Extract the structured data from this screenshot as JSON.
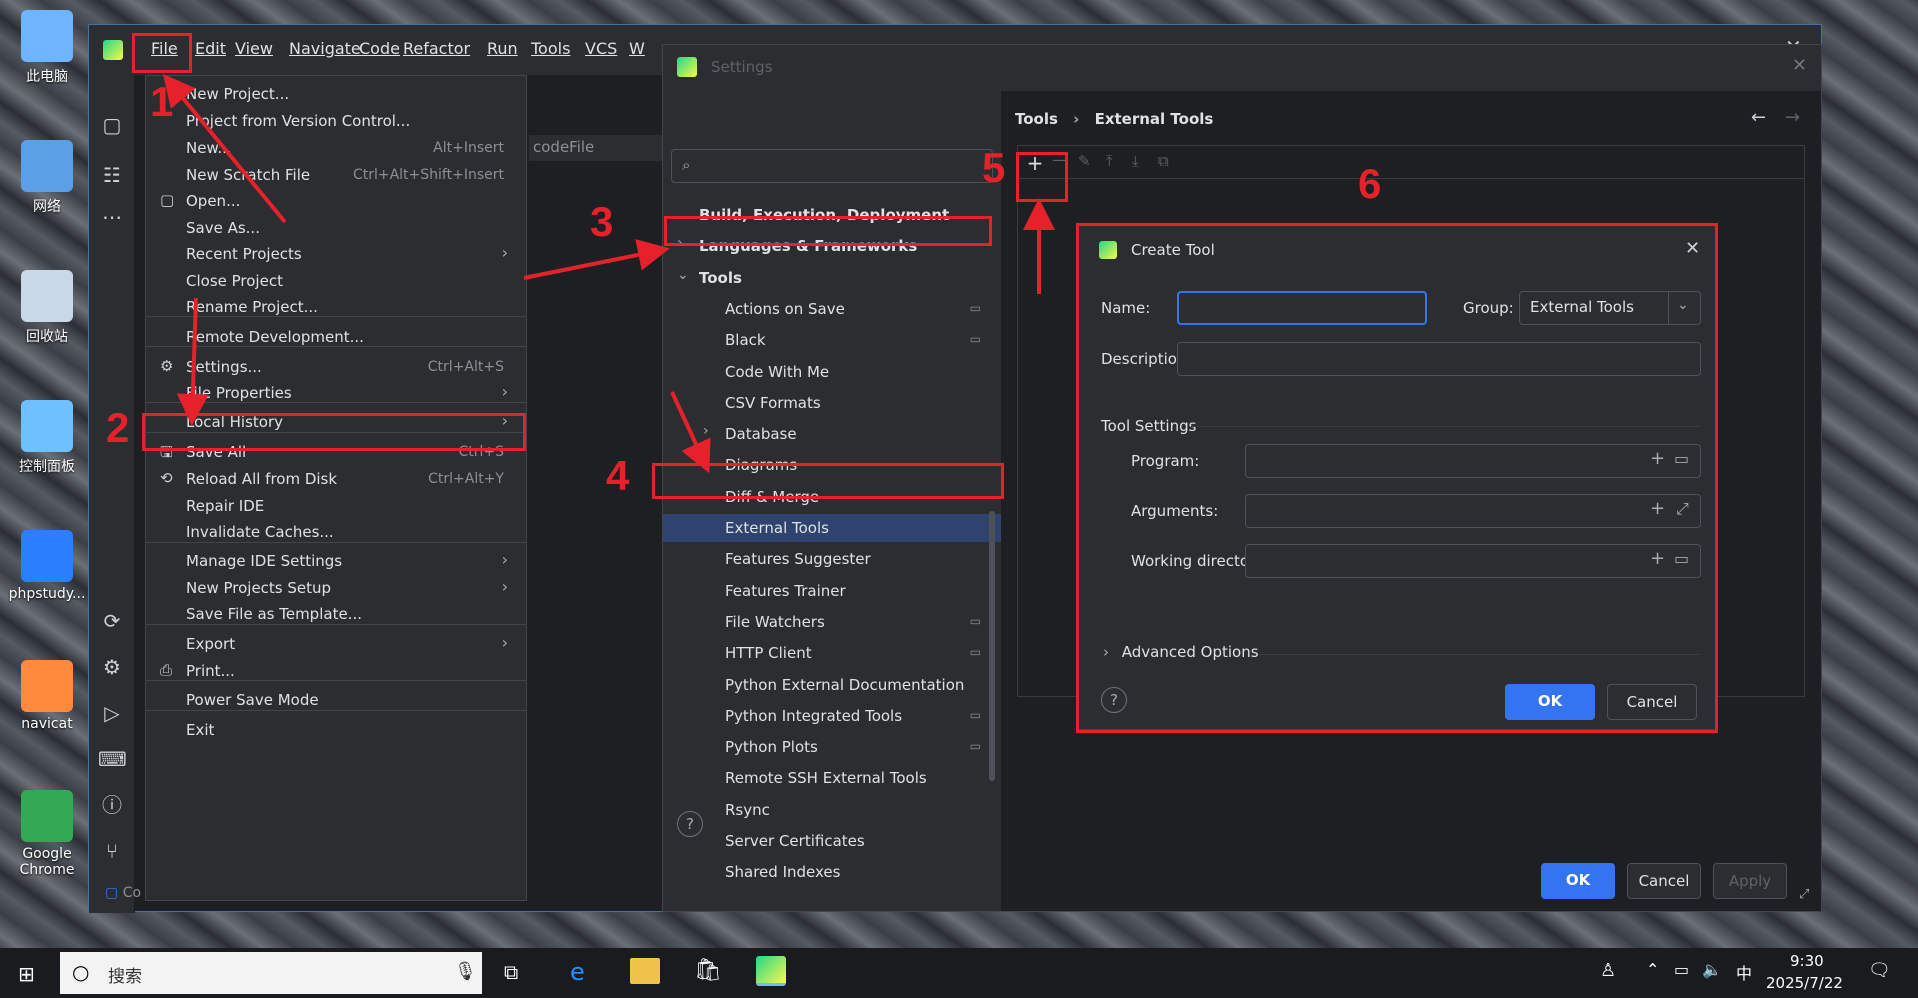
{
  "desktop": {
    "icons": [
      {
        "label": "此电脑",
        "icon": "computer-icon"
      },
      {
        "label": "网络",
        "icon": "network-icon"
      },
      {
        "label": "回收站",
        "icon": "recycle-bin-icon"
      },
      {
        "label": "控制面板",
        "icon": "control-panel-icon"
      },
      {
        "label": "phpstudy...",
        "icon": "phpstudy-icon"
      },
      {
        "label": "navicat",
        "icon": "navicat-icon"
      },
      {
        "label": "Google Chrome",
        "icon": "chrome-icon"
      }
    ]
  },
  "ide": {
    "menu": [
      "File",
      "Edit",
      "View",
      "Navigate",
      "Code",
      "Refactor",
      "Run",
      "Tools",
      "VCS",
      "W"
    ],
    "tab_fragment": "codeFile",
    "status_fragment": "Co"
  },
  "file_menu": {
    "items": [
      {
        "label": "New Project...",
        "shortcut": "",
        "submenu": false,
        "icon": ""
      },
      {
        "label": "Project from Version Control...",
        "shortcut": "",
        "submenu": false,
        "icon": ""
      },
      {
        "label": "New...",
        "shortcut": "Alt+Insert",
        "submenu": false,
        "icon": ""
      },
      {
        "label": "New Scratch File",
        "shortcut": "Ctrl+Alt+Shift+Insert",
        "submenu": false,
        "icon": ""
      },
      {
        "label": "Open...",
        "shortcut": "",
        "submenu": false,
        "icon": "folder-icon"
      },
      {
        "label": "Save As...",
        "shortcut": "",
        "submenu": false,
        "icon": ""
      },
      {
        "label": "Recent Projects",
        "shortcut": "",
        "submenu": true,
        "icon": ""
      },
      {
        "label": "Close Project",
        "shortcut": "",
        "submenu": false,
        "icon": ""
      },
      {
        "label": "Rename Project...",
        "shortcut": "",
        "submenu": false,
        "icon": ""
      },
      {
        "label": "Remote Development...",
        "shortcut": "",
        "submenu": false,
        "icon": ""
      },
      {
        "label": "Settings...",
        "shortcut": "Ctrl+Alt+S",
        "submenu": false,
        "icon": "gear-icon"
      },
      {
        "label": "File Properties",
        "shortcut": "",
        "submenu": true,
        "icon": ""
      },
      {
        "label": "Local History",
        "shortcut": "",
        "submenu": true,
        "icon": ""
      },
      {
        "label": "Save All",
        "shortcut": "Ctrl+S",
        "submenu": false,
        "icon": "save-icon"
      },
      {
        "label": "Reload All from Disk",
        "shortcut": "Ctrl+Alt+Y",
        "submenu": false,
        "icon": "reload-icon"
      },
      {
        "label": "Repair IDE",
        "shortcut": "",
        "submenu": false,
        "icon": ""
      },
      {
        "label": "Invalidate Caches...",
        "shortcut": "",
        "submenu": false,
        "icon": ""
      },
      {
        "label": "Manage IDE Settings",
        "shortcut": "",
        "submenu": true,
        "icon": ""
      },
      {
        "label": "New Projects Setup",
        "shortcut": "",
        "submenu": true,
        "icon": ""
      },
      {
        "label": "Save File as Template...",
        "shortcut": "",
        "submenu": false,
        "icon": ""
      },
      {
        "label": "Export",
        "shortcut": "",
        "submenu": true,
        "icon": ""
      },
      {
        "label": "Print...",
        "shortcut": "",
        "submenu": false,
        "icon": "print-icon"
      },
      {
        "label": "Power Save Mode",
        "shortcut": "",
        "submenu": false,
        "icon": ""
      },
      {
        "label": "Exit",
        "shortcut": "",
        "submenu": false,
        "icon": ""
      }
    ]
  },
  "settings": {
    "title": "Settings",
    "search_placeholder": "",
    "breadcrumb": [
      "Tools",
      "External Tools"
    ],
    "tree": [
      {
        "label": "Build, Execution, Deployment",
        "level": 0,
        "chevron": "",
        "bold": true,
        "marker": false
      },
      {
        "label": "Languages & Frameworks",
        "level": 0,
        "chevron": "›",
        "bold": true,
        "marker": false
      },
      {
        "label": "Tools",
        "level": 0,
        "chevron": "⌄",
        "bold": true,
        "marker": false
      },
      {
        "label": "Actions on Save",
        "level": 1,
        "chevron": "",
        "bold": false,
        "marker": true
      },
      {
        "label": "Black",
        "level": 1,
        "chevron": "",
        "bold": false,
        "marker": true
      },
      {
        "label": "Code With Me",
        "level": 1,
        "chevron": "",
        "bold": false,
        "marker": false
      },
      {
        "label": "CSV Formats",
        "level": 1,
        "chevron": "",
        "bold": false,
        "marker": false
      },
      {
        "label": "Database",
        "level": 1,
        "chevron": "›",
        "bold": false,
        "marker": false
      },
      {
        "label": "Diagrams",
        "level": 1,
        "chevron": "",
        "bold": false,
        "marker": false
      },
      {
        "label": "Diff & Merge",
        "level": 1,
        "chevron": "",
        "bold": false,
        "marker": false
      },
      {
        "label": "External Tools",
        "level": 1,
        "chevron": "",
        "bold": false,
        "marker": false,
        "selected": true
      },
      {
        "label": "Features Suggester",
        "level": 1,
        "chevron": "",
        "bold": false,
        "marker": false
      },
      {
        "label": "Features Trainer",
        "level": 1,
        "chevron": "",
        "bold": false,
        "marker": false
      },
      {
        "label": "File Watchers",
        "level": 1,
        "chevron": "",
        "bold": false,
        "marker": true
      },
      {
        "label": "HTTP Client",
        "level": 1,
        "chevron": "",
        "bold": false,
        "marker": true
      },
      {
        "label": "Python External Documentation",
        "level": 1,
        "chevron": "",
        "bold": false,
        "marker": false
      },
      {
        "label": "Python Integrated Tools",
        "level": 1,
        "chevron": "",
        "bold": false,
        "marker": true
      },
      {
        "label": "Python Plots",
        "level": 1,
        "chevron": "",
        "bold": false,
        "marker": true
      },
      {
        "label": "Remote SSH External Tools",
        "level": 1,
        "chevron": "",
        "bold": false,
        "marker": false
      },
      {
        "label": "Rsync",
        "level": 1,
        "chevron": "",
        "bold": false,
        "marker": false
      },
      {
        "label": "Server Certificates",
        "level": 1,
        "chevron": "",
        "bold": false,
        "marker": false
      },
      {
        "label": "Shared Indexes",
        "level": 1,
        "chevron": "",
        "bold": false,
        "marker": false
      }
    ],
    "ok": "OK",
    "cancel": "Cancel",
    "apply": "Apply"
  },
  "create_tool": {
    "title": "Create Tool",
    "name_label": "Name:",
    "name_value": "",
    "group_label": "Group:",
    "group_value": "External Tools",
    "description_label": "Description:",
    "description_value": "",
    "section_title": "Tool Settings",
    "program_label": "Program:",
    "arguments_label": "Arguments:",
    "working_dir_label": "Working directory:",
    "advanced": "Advanced Options",
    "help": "?",
    "ok": "OK",
    "cancel": "Cancel"
  },
  "annotations": [
    "1",
    "2",
    "3",
    "4",
    "5",
    "6"
  ],
  "taskbar": {
    "search_text": "搜索",
    "time": "9:30",
    "date": "2025/7/22",
    "ime": "中"
  },
  "colors": {
    "annotation_red": "#e5212b",
    "primary_blue": "#3574f0",
    "selection_blue": "#2e436e"
  }
}
